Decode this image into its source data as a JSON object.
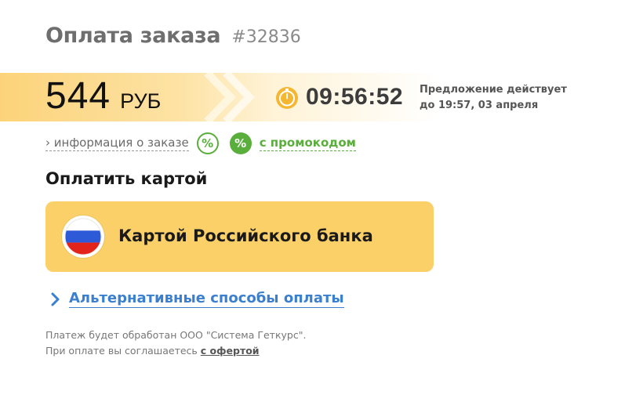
{
  "header": {
    "title": "Оплата заказа",
    "order_number": "#32836"
  },
  "price": {
    "value": "544",
    "currency": "РУБ"
  },
  "timer": {
    "icon": "stopwatch-icon",
    "value": "09:56:52",
    "offer_line1": "Предложение действует",
    "offer_line2": "до 19:57, 03 апреля"
  },
  "links": {
    "order_info": "› информация о заказе",
    "percent_outline_icon": "%",
    "percent_filled_icon": "%",
    "promo": "с промокодом"
  },
  "pay_card": {
    "heading": "Оплатить картой",
    "button_label": "Картой Российского банка",
    "flag_icon": "russia-flag-icon"
  },
  "alternative": {
    "label": "Альтернативные способы оплаты"
  },
  "note": {
    "line1": "Платеж будет обработан ООО \"Система Геткурс\".",
    "line2_prefix": "При оплате вы соглашаетесь ",
    "line2_link": "с офертой"
  },
  "colors": {
    "accent_yellow": "#fcd068",
    "green": "#5aae3c",
    "link_blue": "#3b7fcf",
    "timer_orange": "#f5b731"
  }
}
